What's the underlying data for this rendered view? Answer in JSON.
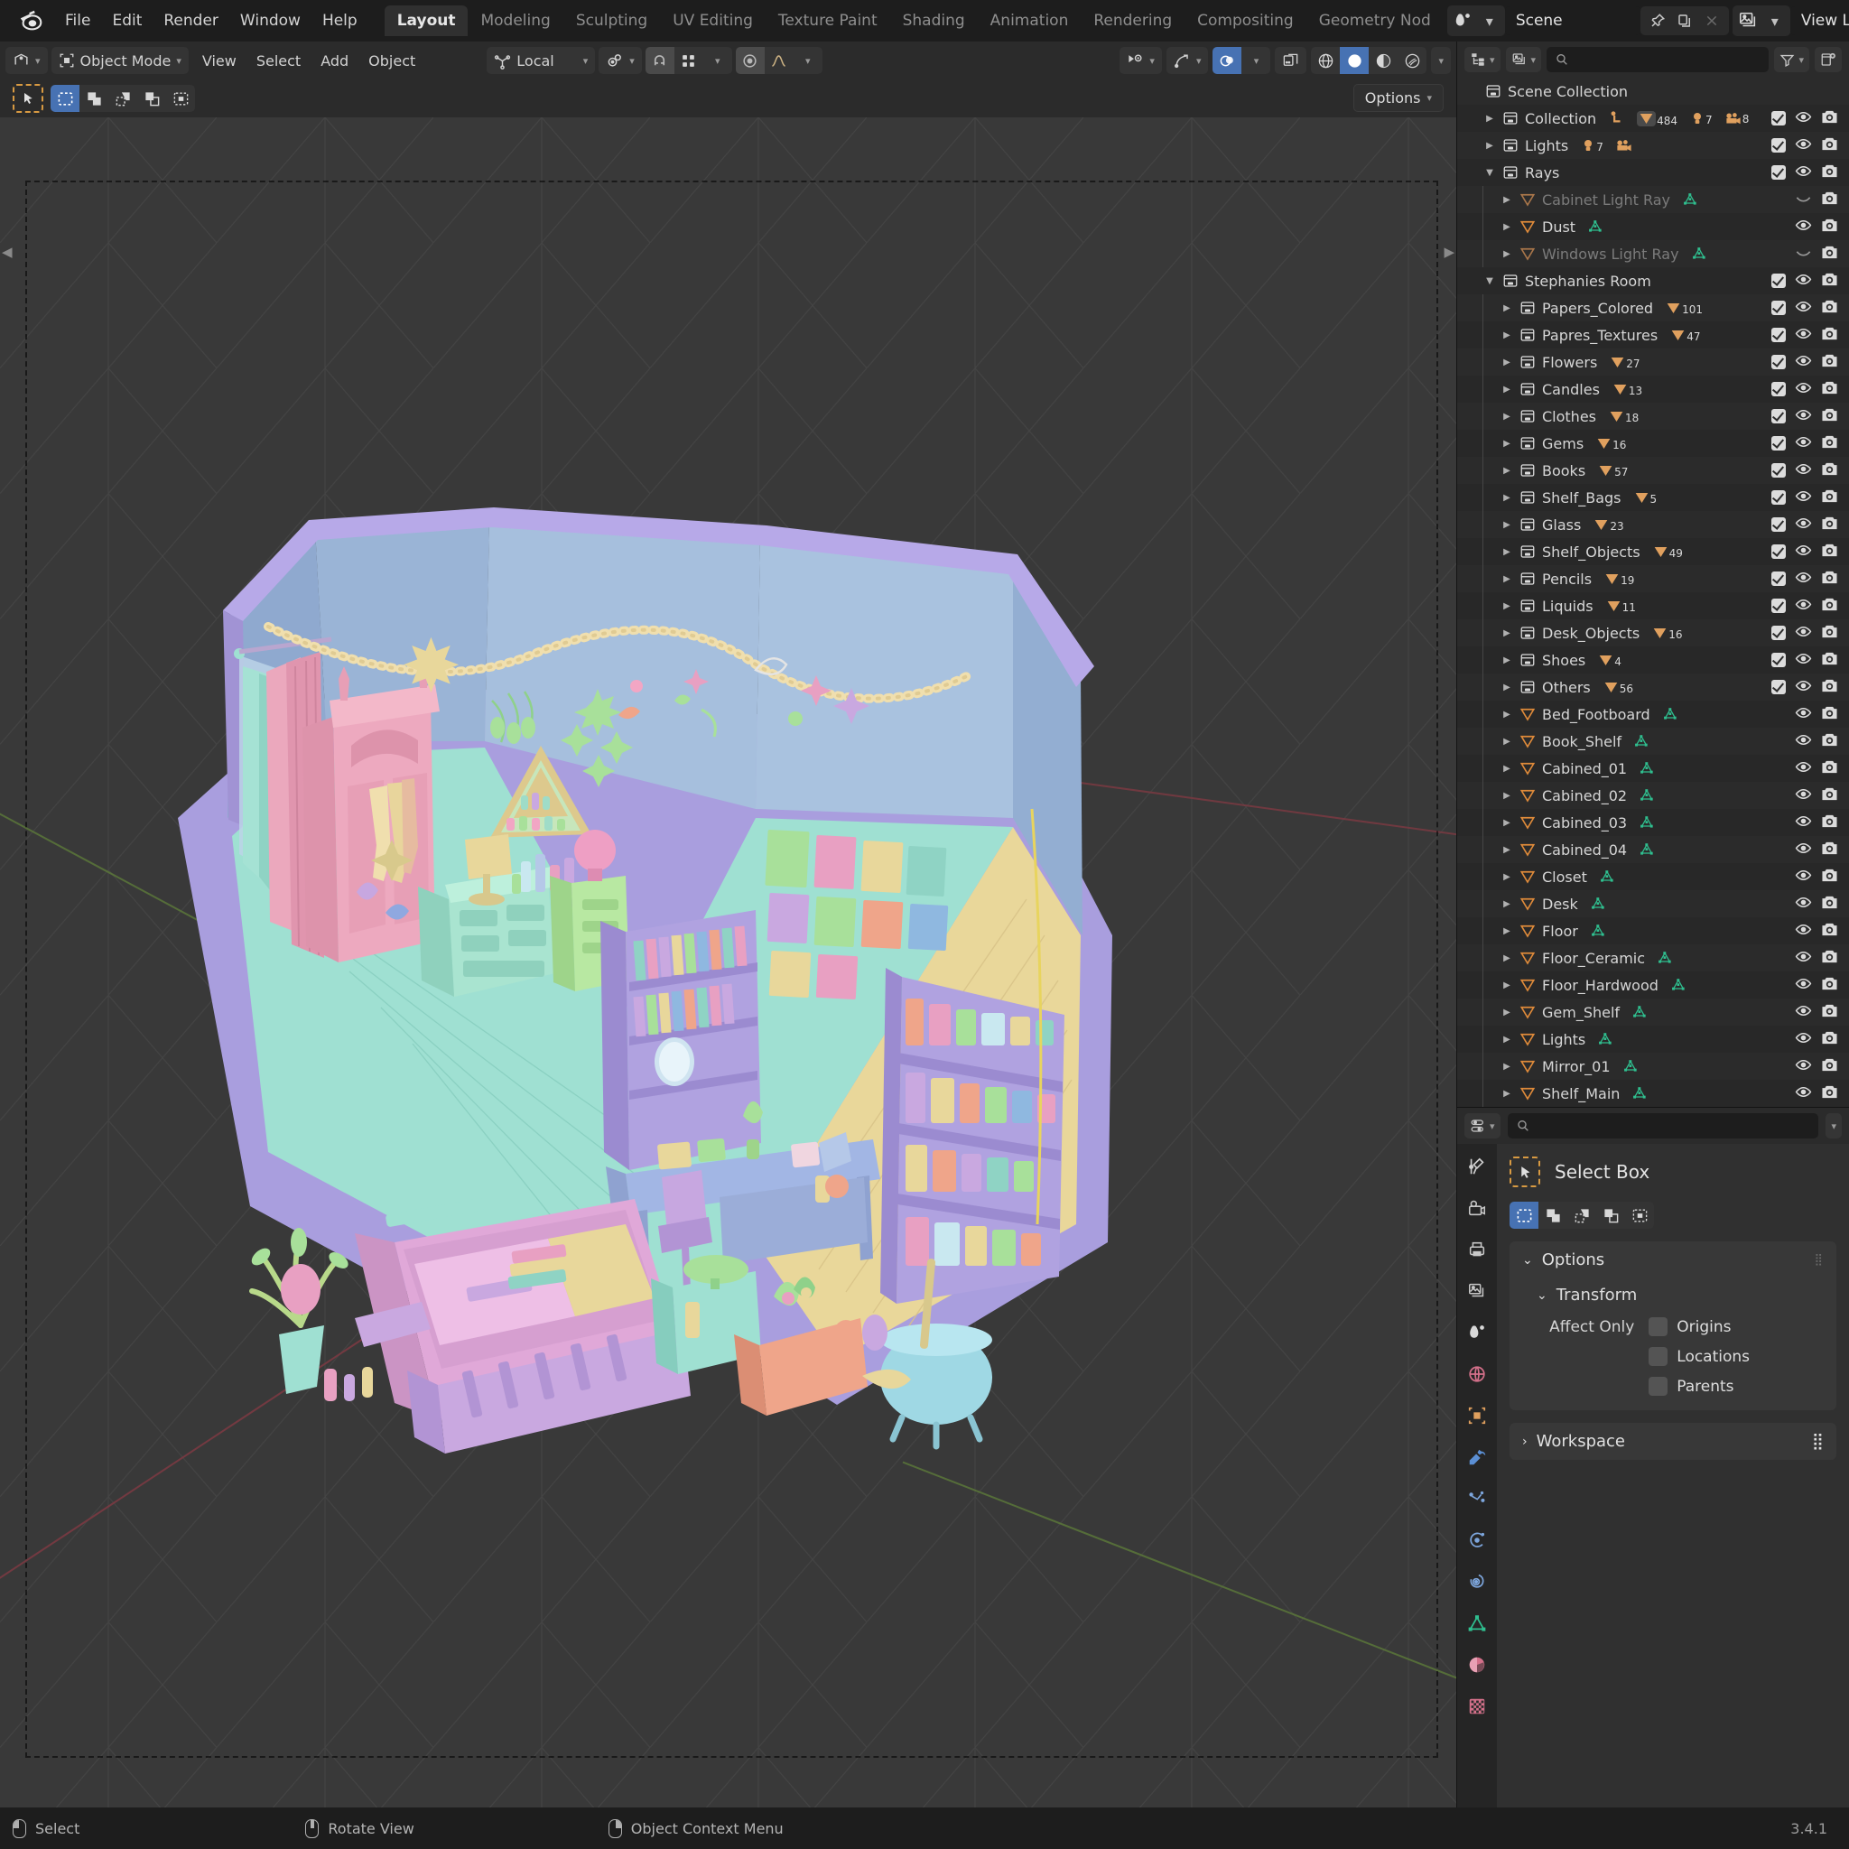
{
  "app": {
    "logo_icon": "blender-logo",
    "version": "3.4.1"
  },
  "topbar": {
    "menus": [
      "File",
      "Edit",
      "Render",
      "Window",
      "Help"
    ],
    "workspace_tabs": [
      {
        "label": "Layout",
        "active": true
      },
      {
        "label": "Modeling",
        "active": false
      },
      {
        "label": "Sculpting",
        "active": false
      },
      {
        "label": "UV Editing",
        "active": false
      },
      {
        "label": "Texture Paint",
        "active": false
      },
      {
        "label": "Shading",
        "active": false
      },
      {
        "label": "Animation",
        "active": false
      },
      {
        "label": "Rendering",
        "active": false
      },
      {
        "label": "Compositing",
        "active": false
      },
      {
        "label": "Geometry Nod",
        "active": false
      }
    ],
    "scene_icon": "scene-data-icon",
    "scene_name": "Scene",
    "pin_icon": "pin-icon",
    "copy_scene_icon": "duplicate-icon",
    "close_scene_icon": "x-icon",
    "viewlayer_icon": "view-layer-icon",
    "viewlayer_name": "View Layer",
    "copy_viewlayer_icon": "duplicate-icon",
    "close_viewlayer_icon": "x-icon"
  },
  "viewport_header": {
    "editor_type_icon": "editor-type-3dview-icon",
    "mode": "Object Mode",
    "mode_icon": "object-mode-icon",
    "menus": [
      "View",
      "Select",
      "Add",
      "Object"
    ],
    "transform_orientation_icon": "orientation-icon",
    "transform_orientation": "Local",
    "pivot_icon": "pivot-point-icon",
    "snap_magnet_icon": "magnet-icon",
    "snap_to_icon": "snap-grid-icon",
    "proportional_icon": "proportional-edit-icon",
    "falloff_icon": "falloff-smooth-icon",
    "visibility_icon": "object-visibility-icon",
    "gizmo_icon": "gizmo-icon",
    "overlays_icon": "overlays-icon",
    "xray_icon": "xray-toggle-icon",
    "shading_modes": [
      {
        "name": "wireframe-shading-icon",
        "active": false
      },
      {
        "name": "solid-shading-icon",
        "active": true
      },
      {
        "name": "material-preview-shading-icon",
        "active": false
      },
      {
        "name": "rendered-shading-icon",
        "active": false
      }
    ]
  },
  "tool_header": {
    "active_tool_icon": "select-box-cursor-icon",
    "select_modes": [
      {
        "name": "set-select-mode-icon",
        "active": true
      },
      {
        "name": "extend-select-mode-icon",
        "active": false
      },
      {
        "name": "subtract-select-mode-icon",
        "active": false
      },
      {
        "name": "invert-select-mode-icon",
        "active": false
      },
      {
        "name": "intersect-select-mode-icon",
        "active": false
      }
    ],
    "options_label": "Options",
    "options_chevron_icon": "chevron-down-icon"
  },
  "outliner": {
    "display_mode_icon": "outliner-display-mode-icon",
    "filter_id_icon": "view-layer-icon",
    "search_placeholder": "",
    "search_icon": "search-icon",
    "filter_icon": "funnel-filter-icon",
    "new_collection_icon": "new-collection-icon",
    "rows": [
      {
        "label": "Scene Collection",
        "indent": 0,
        "icon": "collection-icon",
        "disclosure": "none",
        "dim": false,
        "badges": [],
        "mesh": false,
        "checkbox": false,
        "eye": "none",
        "camera": false
      },
      {
        "label": "Collection",
        "indent": 1,
        "icon": "collection-icon",
        "disclosure": "closed",
        "dim": false,
        "badges": [
          {
            "icon": "armature-icon",
            "count": ""
          },
          {
            "icon": "mesh-data-icon",
            "count": "484",
            "highlight": true
          },
          {
            "icon": "light-data-icon",
            "count": "7"
          },
          {
            "icon": "camera-data-icon",
            "count": "8"
          }
        ],
        "mesh": false,
        "checkbox": true,
        "eye": "open",
        "camera": true
      },
      {
        "label": "Lights",
        "indent": 1,
        "icon": "collection-icon",
        "disclosure": "closed",
        "dim": false,
        "badges": [
          {
            "icon": "light-data-icon",
            "count": "7"
          },
          {
            "icon": "camera-data-icon",
            "count": ""
          }
        ],
        "mesh": false,
        "checkbox": true,
        "eye": "open",
        "camera": true
      },
      {
        "label": "Rays",
        "indent": 1,
        "icon": "collection-icon",
        "disclosure": "open",
        "dim": false,
        "badges": [],
        "mesh": false,
        "checkbox": true,
        "eye": "open",
        "camera": true
      },
      {
        "label": "Cabinet Light Ray",
        "indent": 2,
        "icon": "object-mesh-icon",
        "disclosure": "closed",
        "dim": true,
        "badges": [],
        "mesh": true,
        "checkbox": false,
        "eye": "closed",
        "camera": true
      },
      {
        "label": "Dust",
        "indent": 2,
        "icon": "object-mesh-icon",
        "disclosure": "closed",
        "dim": false,
        "badges": [],
        "mesh": true,
        "checkbox": false,
        "eye": "open",
        "camera": true
      },
      {
        "label": "Windows Light Ray",
        "indent": 2,
        "icon": "object-mesh-icon",
        "disclosure": "closed",
        "dim": true,
        "badges": [],
        "mesh": true,
        "checkbox": false,
        "eye": "closed",
        "camera": true
      },
      {
        "label": "Stephanies Room",
        "indent": 1,
        "icon": "collection-icon",
        "disclosure": "open",
        "dim": false,
        "badges": [],
        "mesh": false,
        "checkbox": true,
        "eye": "open",
        "camera": true
      },
      {
        "label": "Papers_Colored",
        "indent": 2,
        "icon": "collection-icon",
        "disclosure": "closed",
        "dim": false,
        "badges": [
          {
            "icon": "mesh-data-icon",
            "count": "101"
          }
        ],
        "mesh": false,
        "checkbox": true,
        "eye": "open",
        "camera": true
      },
      {
        "label": "Papres_Textures",
        "indent": 2,
        "icon": "collection-icon",
        "disclosure": "closed",
        "dim": false,
        "badges": [
          {
            "icon": "mesh-data-icon",
            "count": "47"
          }
        ],
        "mesh": false,
        "checkbox": true,
        "eye": "open",
        "camera": true
      },
      {
        "label": "Flowers",
        "indent": 2,
        "icon": "collection-icon",
        "disclosure": "closed",
        "dim": false,
        "badges": [
          {
            "icon": "mesh-data-icon",
            "count": "27"
          }
        ],
        "mesh": false,
        "checkbox": true,
        "eye": "open",
        "camera": true
      },
      {
        "label": "Candles",
        "indent": 2,
        "icon": "collection-icon",
        "disclosure": "closed",
        "dim": false,
        "badges": [
          {
            "icon": "mesh-data-icon",
            "count": "13"
          }
        ],
        "mesh": false,
        "checkbox": true,
        "eye": "open",
        "camera": true
      },
      {
        "label": "Clothes",
        "indent": 2,
        "icon": "collection-icon",
        "disclosure": "closed",
        "dim": false,
        "badges": [
          {
            "icon": "mesh-data-icon",
            "count": "18"
          }
        ],
        "mesh": false,
        "checkbox": true,
        "eye": "open",
        "camera": true
      },
      {
        "label": "Gems",
        "indent": 2,
        "icon": "collection-icon",
        "disclosure": "closed",
        "dim": false,
        "badges": [
          {
            "icon": "mesh-data-icon",
            "count": "16"
          }
        ],
        "mesh": false,
        "checkbox": true,
        "eye": "open",
        "camera": true
      },
      {
        "label": "Books",
        "indent": 2,
        "icon": "collection-icon",
        "disclosure": "closed",
        "dim": false,
        "badges": [
          {
            "icon": "mesh-data-icon",
            "count": "57"
          }
        ],
        "mesh": false,
        "checkbox": true,
        "eye": "open",
        "camera": true
      },
      {
        "label": "Shelf_Bags",
        "indent": 2,
        "icon": "collection-icon",
        "disclosure": "closed",
        "dim": false,
        "badges": [
          {
            "icon": "mesh-data-icon",
            "count": "5"
          }
        ],
        "mesh": false,
        "checkbox": true,
        "eye": "open",
        "camera": true
      },
      {
        "label": "Glass",
        "indent": 2,
        "icon": "collection-icon",
        "disclosure": "closed",
        "dim": false,
        "badges": [
          {
            "icon": "mesh-data-icon",
            "count": "23"
          }
        ],
        "mesh": false,
        "checkbox": true,
        "eye": "open",
        "camera": true
      },
      {
        "label": "Shelf_Objects",
        "indent": 2,
        "icon": "collection-icon",
        "disclosure": "closed",
        "dim": false,
        "badges": [
          {
            "icon": "mesh-data-icon",
            "count": "49"
          }
        ],
        "mesh": false,
        "checkbox": true,
        "eye": "open",
        "camera": true
      },
      {
        "label": "Pencils",
        "indent": 2,
        "icon": "collection-icon",
        "disclosure": "closed",
        "dim": false,
        "badges": [
          {
            "icon": "mesh-data-icon",
            "count": "19"
          }
        ],
        "mesh": false,
        "checkbox": true,
        "eye": "open",
        "camera": true
      },
      {
        "label": "Liquids",
        "indent": 2,
        "icon": "collection-icon",
        "disclosure": "closed",
        "dim": false,
        "badges": [
          {
            "icon": "mesh-data-icon",
            "count": "11"
          }
        ],
        "mesh": false,
        "checkbox": true,
        "eye": "open",
        "camera": true
      },
      {
        "label": "Desk_Objects",
        "indent": 2,
        "icon": "collection-icon",
        "disclosure": "closed",
        "dim": false,
        "badges": [
          {
            "icon": "mesh-data-icon",
            "count": "16"
          }
        ],
        "mesh": false,
        "checkbox": true,
        "eye": "open",
        "camera": true
      },
      {
        "label": "Shoes",
        "indent": 2,
        "icon": "collection-icon",
        "disclosure": "closed",
        "dim": false,
        "badges": [
          {
            "icon": "mesh-data-icon",
            "count": "4"
          }
        ],
        "mesh": false,
        "checkbox": true,
        "eye": "open",
        "camera": true
      },
      {
        "label": "Others",
        "indent": 2,
        "icon": "collection-icon",
        "disclosure": "closed",
        "dim": false,
        "badges": [
          {
            "icon": "mesh-data-icon",
            "count": "56"
          }
        ],
        "mesh": false,
        "checkbox": true,
        "eye": "open",
        "camera": true
      },
      {
        "label": "Bed_Footboard",
        "indent": 2,
        "icon": "object-mesh-icon",
        "disclosure": "closed",
        "dim": false,
        "badges": [],
        "mesh": true,
        "checkbox": false,
        "eye": "open",
        "camera": true
      },
      {
        "label": "Book_Shelf",
        "indent": 2,
        "icon": "object-mesh-icon",
        "disclosure": "closed",
        "dim": false,
        "badges": [],
        "mesh": true,
        "checkbox": false,
        "eye": "open",
        "camera": true
      },
      {
        "label": "Cabined_01",
        "indent": 2,
        "icon": "object-mesh-icon",
        "disclosure": "closed",
        "dim": false,
        "badges": [],
        "mesh": true,
        "checkbox": false,
        "eye": "open",
        "camera": true
      },
      {
        "label": "Cabined_02",
        "indent": 2,
        "icon": "object-mesh-icon",
        "disclosure": "closed",
        "dim": false,
        "badges": [],
        "mesh": true,
        "checkbox": false,
        "eye": "open",
        "camera": true
      },
      {
        "label": "Cabined_03",
        "indent": 2,
        "icon": "object-mesh-icon",
        "disclosure": "closed",
        "dim": false,
        "badges": [],
        "mesh": true,
        "checkbox": false,
        "eye": "open",
        "camera": true
      },
      {
        "label": "Cabined_04",
        "indent": 2,
        "icon": "object-mesh-icon",
        "disclosure": "closed",
        "dim": false,
        "badges": [],
        "mesh": true,
        "checkbox": false,
        "eye": "open",
        "camera": true
      },
      {
        "label": "Closet",
        "indent": 2,
        "icon": "object-mesh-icon",
        "disclosure": "closed",
        "dim": false,
        "badges": [],
        "mesh": true,
        "checkbox": false,
        "eye": "open",
        "camera": true
      },
      {
        "label": "Desk",
        "indent": 2,
        "icon": "object-mesh-icon",
        "disclosure": "closed",
        "dim": false,
        "badges": [],
        "mesh": true,
        "checkbox": false,
        "eye": "open",
        "camera": true
      },
      {
        "label": "Floor",
        "indent": 2,
        "icon": "object-mesh-icon",
        "disclosure": "closed",
        "dim": false,
        "badges": [],
        "mesh": true,
        "checkbox": false,
        "eye": "open",
        "camera": true
      },
      {
        "label": "Floor_Ceramic",
        "indent": 2,
        "icon": "object-mesh-icon",
        "disclosure": "closed",
        "dim": false,
        "badges": [],
        "mesh": true,
        "checkbox": false,
        "eye": "open",
        "camera": true
      },
      {
        "label": "Floor_Hardwood",
        "indent": 2,
        "icon": "object-mesh-icon",
        "disclosure": "closed",
        "dim": false,
        "badges": [],
        "mesh": true,
        "checkbox": false,
        "eye": "open",
        "camera": true
      },
      {
        "label": "Gem_Shelf",
        "indent": 2,
        "icon": "object-mesh-icon",
        "disclosure": "closed",
        "dim": false,
        "badges": [],
        "mesh": true,
        "checkbox": false,
        "eye": "open",
        "camera": true
      },
      {
        "label": "Lights",
        "indent": 2,
        "icon": "object-mesh-icon",
        "disclosure": "closed",
        "dim": false,
        "badges": [],
        "mesh": true,
        "checkbox": false,
        "eye": "open",
        "camera": true
      },
      {
        "label": "Mirror_01",
        "indent": 2,
        "icon": "object-mesh-icon",
        "disclosure": "closed",
        "dim": false,
        "badges": [],
        "mesh": true,
        "checkbox": false,
        "eye": "open",
        "camera": true
      },
      {
        "label": "Shelf_Main",
        "indent": 2,
        "icon": "object-mesh-icon",
        "disclosure": "closed",
        "dim": false,
        "badges": [],
        "mesh": true,
        "checkbox": false,
        "eye": "open",
        "camera": true
      }
    ]
  },
  "properties": {
    "editor_type_icon": "editor-type-properties-icon",
    "search_placeholder": "",
    "search_icon": "search-icon",
    "dropdown_icon": "chevron-down-icon",
    "tabs": [
      {
        "name": "tool-tab-icon",
        "active": true
      },
      {
        "name": "render-tab-icon",
        "active": false
      },
      {
        "name": "output-tab-icon",
        "active": false
      },
      {
        "name": "view-layer-tab-icon",
        "active": false
      },
      {
        "name": "scene-tab-icon",
        "active": false
      },
      {
        "name": "world-tab-icon",
        "active": false
      },
      {
        "name": "object-tab-icon",
        "active": false
      },
      {
        "name": "modifier-tab-icon",
        "active": false
      },
      {
        "name": "particles-tab-icon",
        "active": false
      },
      {
        "name": "physics-tab-icon",
        "active": false
      },
      {
        "name": "constraints-tab-icon",
        "active": false
      },
      {
        "name": "object-data-tab-icon",
        "active": false
      },
      {
        "name": "material-tab-icon",
        "active": false
      },
      {
        "name": "texture-tab-icon",
        "active": false
      }
    ],
    "active_tool": {
      "icon": "select-box-cursor-icon",
      "label": "Select Box",
      "modes": [
        {
          "name": "set-select-mode-icon",
          "active": true
        },
        {
          "name": "extend-select-mode-icon",
          "active": false
        },
        {
          "name": "subtract-select-mode-icon",
          "active": false
        },
        {
          "name": "invert-select-mode-icon",
          "active": false
        },
        {
          "name": "intersect-select-mode-icon",
          "active": false
        }
      ]
    },
    "options_panel": {
      "title": "Options",
      "expanded": true,
      "transform_title": "Transform",
      "affect_only_label": "Affect Only",
      "checkboxes": [
        {
          "label": "Origins",
          "checked": false
        },
        {
          "label": "Locations",
          "checked": false
        },
        {
          "label": "Parents",
          "checked": false
        }
      ]
    },
    "workspace_panel": {
      "title": "Workspace",
      "expanded": false
    }
  },
  "statusbar": {
    "items": [
      {
        "icon": "mouse-left-icon",
        "label": "Select"
      },
      {
        "icon": "mouse-middle-icon",
        "label": "Rotate View"
      },
      {
        "icon": "mouse-right-icon",
        "label": "Object Context Menu"
      }
    ],
    "version": "3.4.1"
  }
}
